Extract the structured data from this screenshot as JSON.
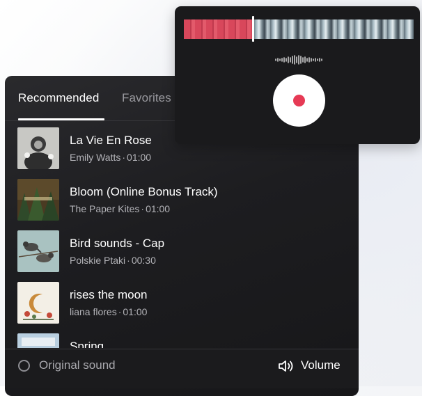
{
  "tabs": {
    "recommended": "Recommended",
    "favorites": "Favorites"
  },
  "tracks": [
    {
      "title": "La Vie En Rose",
      "artist": "Emily Watts",
      "duration": "01:00",
      "cover": "portrait-photo"
    },
    {
      "title": "Bloom (Online Bonus Track)",
      "artist": "The Paper Kites",
      "duration": "01:00",
      "cover": "forest-art"
    },
    {
      "title": "Bird sounds - Cap",
      "artist": "Polskie Ptaki",
      "duration": "00:30",
      "cover": "birds-art"
    },
    {
      "title": "rises the moon",
      "artist": "liana flores",
      "duration": "01:00",
      "cover": "moon-art"
    },
    {
      "title": "Spring",
      "artist": "",
      "duration": "",
      "cover": "spring-art"
    }
  ],
  "separator": "·",
  "footer": {
    "original_sound": "Original sound",
    "volume": "Volume"
  },
  "recorder": {
    "record_icon": "record-button",
    "waveform_icon": "audio-waveform-icon"
  },
  "colors": {
    "panel_bg": "#1d1d20",
    "record_red": "#e63a55",
    "trim_red": "#d8475b"
  }
}
